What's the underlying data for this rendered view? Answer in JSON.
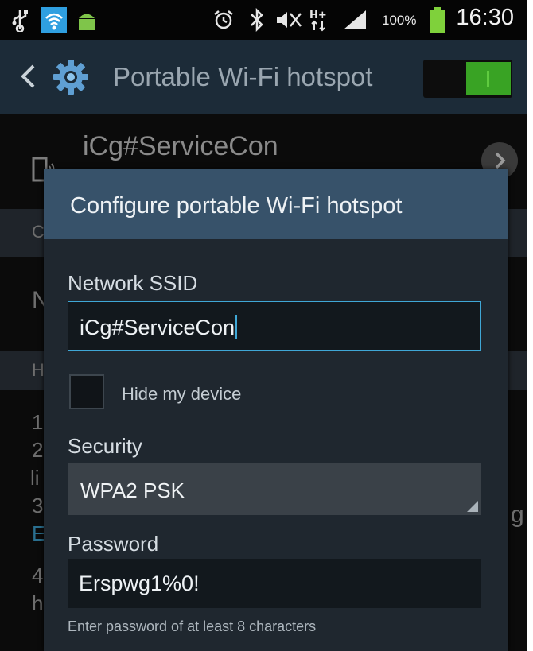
{
  "status_bar": {
    "battery_percent": "100%",
    "time": "16:30",
    "icons": [
      "usb-icon",
      "wifi-hotspot-icon",
      "android-icon",
      "alarm-icon",
      "bluetooth-icon",
      "mute-icon",
      "hplus-data-icon",
      "signal-icon",
      "battery-icon"
    ]
  },
  "action_bar": {
    "title": "Portable Wi-Fi hotspot",
    "toggle_on": true
  },
  "background": {
    "network_name": "iCg#ServiceCon",
    "peek_letters": [
      "C",
      "N",
      "H",
      "1",
      "2",
      "li",
      "3",
      "E",
      "4",
      "h",
      "g"
    ]
  },
  "dialog": {
    "title": "Configure portable Wi-Fi hotspot",
    "ssid_label": "Network SSID",
    "ssid_value": "iCg#ServiceCon",
    "hide_device_label": "Hide my device",
    "hide_device_checked": false,
    "security_label": "Security",
    "security_value": "WPA2 PSK",
    "password_label": "Password",
    "password_value": "Erspwg1%0!",
    "password_hint": "Enter password of at least 8 characters"
  },
  "colors": {
    "action_bar": "#1c2b38",
    "dialog_header": "#37526a",
    "dialog_body": "#1f272f",
    "accent": "#3fa7d6",
    "toggle_on": "#39a324"
  }
}
